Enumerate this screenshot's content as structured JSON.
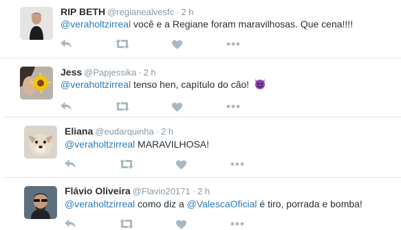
{
  "tweets": [
    {
      "name": "RIP BETH",
      "handle": "@regianealvesfc",
      "separator": "·",
      "time": "2 h",
      "mention": "@veraholtzirreal",
      "text": " você e a Regiane foram maravilhosas. Que cena!!!!"
    },
    {
      "name": "Jess",
      "handle": "@Papjessika",
      "separator": "·",
      "time": "2 h",
      "mention": "@veraholtzirreal",
      "text": " tenso hen, capítulo do cão! ",
      "emoji": "smiling-imp-emoji"
    },
    {
      "name": "Eliana",
      "handle": "@eudarquinha",
      "separator": "·",
      "time": "2 h",
      "mention": "@veraholtzirreal",
      "text": " MARAVILHOSA!"
    },
    {
      "name": "Flávio Oliveira",
      "handle": "@Flavio20171",
      "separator": "·",
      "time": "2 h",
      "mention": "@veraholtzirreal",
      "text": " como diz a ",
      "mention2": "@ValescaOficial",
      "text2": " é tiro, porrada e bomba!"
    }
  ],
  "icons": {
    "reply": "reply-icon",
    "retweet": "retweet-icon",
    "like": "heart-icon",
    "more": "more-icon"
  },
  "colors": {
    "link": "#2b7bb9",
    "muted": "#8899a6",
    "text": "#292f33",
    "separator": "#e1e8ed",
    "icon": "#aab8c2"
  }
}
